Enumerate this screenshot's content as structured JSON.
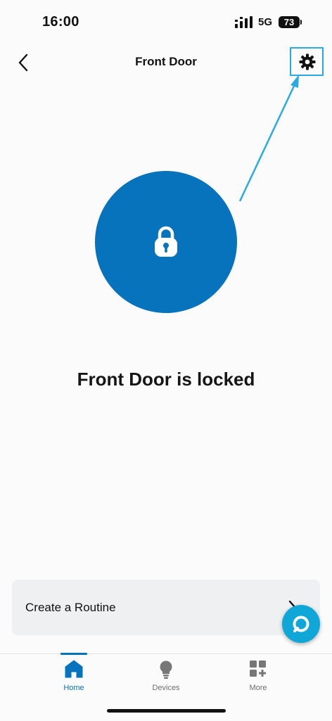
{
  "status_bar": {
    "time": "16:00",
    "network": "5G",
    "battery": "73",
    "signal_icon": "signal-bars-icon"
  },
  "header": {
    "title": "Front Door",
    "back_icon": "chevron-left-icon",
    "settings_icon": "gear-icon"
  },
  "lock": {
    "icon": "padlock-icon",
    "status_text": "Front Door is locked",
    "accent_color": "#0673bc"
  },
  "routine": {
    "label": "Create a Routine",
    "chevron_icon": "chevron-right-icon"
  },
  "alexa": {
    "icon": "alexa-ring-icon",
    "color": "#0fa7d8"
  },
  "bottom_nav": {
    "items": [
      {
        "label": "Home",
        "icon": "home-icon",
        "active": true
      },
      {
        "label": "Devices",
        "icon": "lightbulb-icon",
        "active": false
      },
      {
        "label": "More",
        "icon": "grid-plus-icon",
        "active": false
      }
    ]
  },
  "annotation": {
    "color": "#29abe2"
  }
}
